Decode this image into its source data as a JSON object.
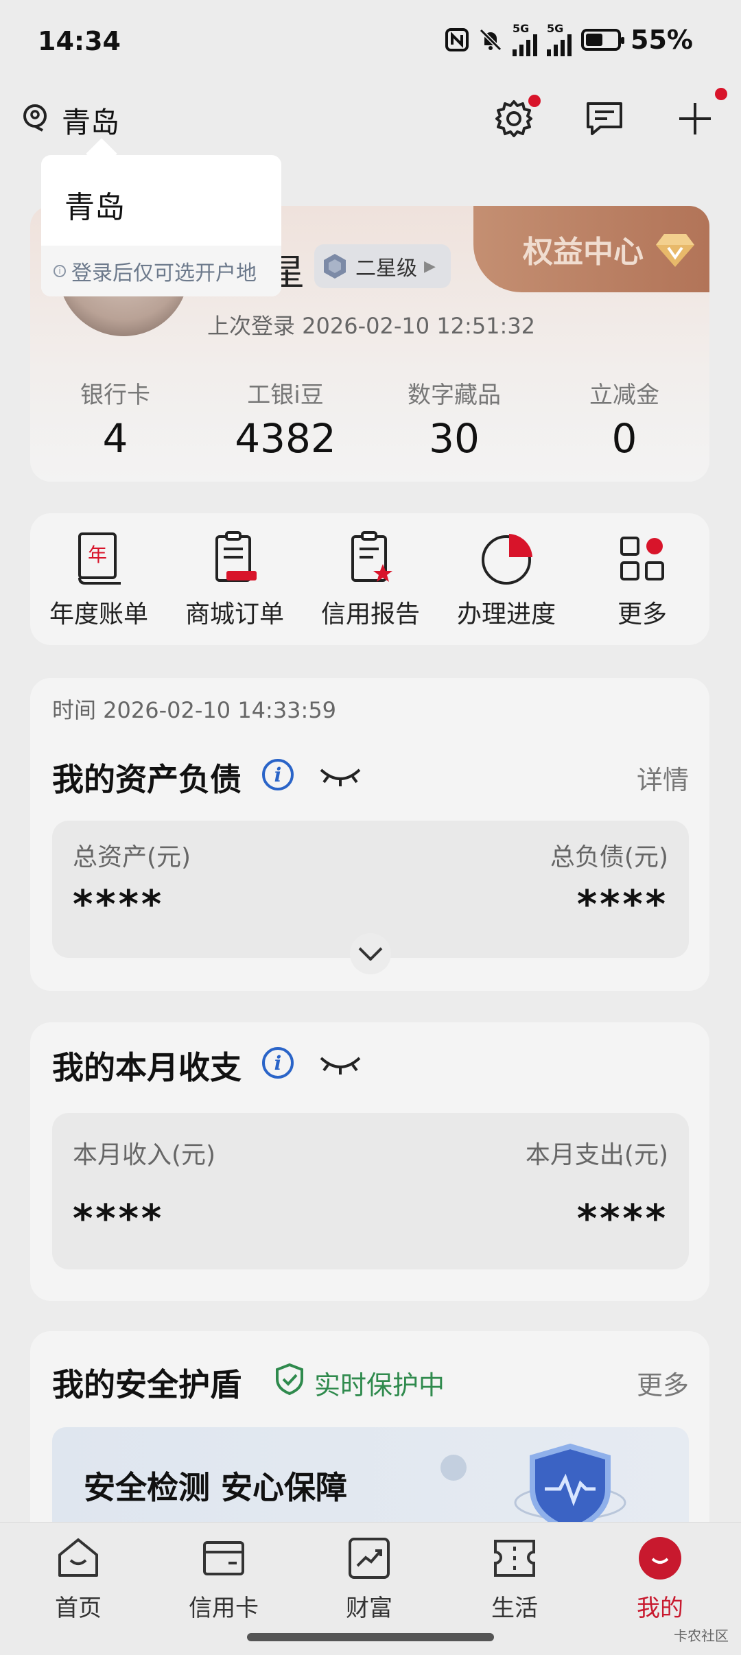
{
  "status_bar": {
    "time": "14:34",
    "battery": "55%",
    "battery_level": 0.55,
    "network_1": "5G",
    "network_2": "5G"
  },
  "header": {
    "location": "青岛"
  },
  "popup": {
    "title": "青岛",
    "note": "登录后仅可选开户地"
  },
  "profile": {
    "name_glyph": "星",
    "level": "二星级",
    "rights_center": "权益中心",
    "last_login": "上次登录 2026-02-10 12:51:32",
    "stats": [
      {
        "label": "银行卡",
        "value": "4"
      },
      {
        "label": "工银i豆",
        "value": "4382"
      },
      {
        "label": "数字藏品",
        "value": "30"
      },
      {
        "label": "立减金",
        "value": "0"
      }
    ]
  },
  "quick_menu": [
    {
      "label": "年度账单",
      "icon": "annual-bill-icon"
    },
    {
      "label": "商城订单",
      "icon": "mall-order-icon"
    },
    {
      "label": "信用报告",
      "icon": "credit-report-icon"
    },
    {
      "label": "办理进度",
      "icon": "progress-icon"
    },
    {
      "label": "更多",
      "icon": "more-grid-icon"
    }
  ],
  "assets": {
    "time": "时间 2026-02-10 14:33:59",
    "title": "我的资产负债",
    "detail": "详情",
    "total_assets_label": "总资产(元)",
    "total_assets_value": "****",
    "total_liab_label": "总负债(元)",
    "total_liab_value": "****"
  },
  "monthly": {
    "title": "我的本月收支",
    "income_label": "本月收入(元)",
    "income_value": "****",
    "expense_label": "本月支出(元)",
    "expense_value": "****"
  },
  "shield": {
    "title": "我的安全护盾",
    "status": "实时保护中",
    "more": "更多",
    "banner_text": "安全检测 安心保障"
  },
  "bottom_nav": [
    {
      "label": "首页",
      "icon": "home-icon"
    },
    {
      "label": "信用卡",
      "icon": "credit-card-icon"
    },
    {
      "label": "财富",
      "icon": "wealth-icon"
    },
    {
      "label": "生活",
      "icon": "life-ticket-icon"
    },
    {
      "label": "我的",
      "icon": "mine-icon",
      "active": true
    }
  ],
  "watermark": "卡农社区",
  "colors": {
    "accent_red": "#d8142a",
    "info_blue": "#2a64c8",
    "shield_green": "#2f8a4d"
  }
}
